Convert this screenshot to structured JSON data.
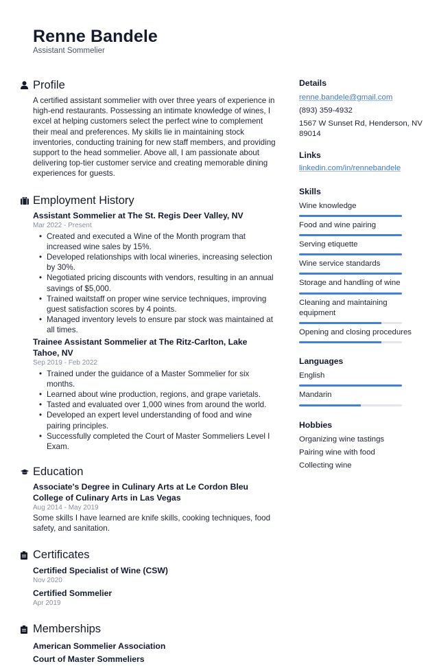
{
  "header": {
    "name": "Renne Bandele",
    "title": "Assistant Sommelier"
  },
  "colors": {
    "accent": "#3d7fe8",
    "bar_track": "#e3e5ea",
    "text": "#1f2433",
    "muted": "#8b909c",
    "link": "#3d78d8"
  },
  "profile": {
    "heading": "Profile",
    "icon": "user-icon",
    "text": "A certified assistant sommelier with over three years of experience in high-end restaurants. Possessing an intimate knowledge of wines, I excel at helping customers select the perfect wine to complement their meal and preferences. My skills lie in maintaining stock inventories, conducting training for new staff members, and providing support to the head sommelier. Above all, I am passionate about delivering top-tier customer service and creating memorable dining experiences for guests."
  },
  "employment": {
    "heading": "Employment History",
    "icon": "briefcase-icon",
    "jobs": [
      {
        "title": "Assistant Sommelier at The St. Regis Deer Valley, NV",
        "dates": "Mar 2022 - Present",
        "bullets": [
          "Created and executed a Wine of the Month program that increased wine sales by 15%.",
          "Developed relationships with local wineries, increasing selection by 30%.",
          "Negotiated pricing discounts with vendors, resulting in an annual savings of $5,000.",
          "Trained waitstaff on proper wine service techniques, improving guest satisfaction scores by 4 points.",
          "Managed inventory levels to ensure par stock was maintained at all times."
        ]
      },
      {
        "title": "Trainee Assistant Sommelier at The Ritz-Carlton, Lake Tahoe, NV",
        "dates": "Sep 2019 - Feb 2022",
        "bullets": [
          "Trained under the guidance of a Master Sommelier for six months.",
          "Learned about wine production, regions, and grape varietals.",
          "Tasted and evaluated over 1,000 wines from around the world.",
          "Developed an expert level understanding of food and wine pairing principles.",
          "Successfully completed the Court of Master Sommeliers Level I Exam."
        ]
      }
    ]
  },
  "education": {
    "heading": "Education",
    "icon": "graduation-cap-icon",
    "entries": [
      {
        "title": "Associate's Degree in Culinary Arts at Le Cordon Bleu College of Culinary Arts in Las Vegas",
        "dates": "Aug 2014 - May 2019",
        "description": "Some skills I have learned are knife skills, cooking techniques, food safety, and sanitation."
      }
    ]
  },
  "certificates": {
    "heading": "Certificates",
    "icon": "clipboard-icon",
    "items": [
      {
        "title": "Certified Specialist of Wine (CSW)",
        "date": "Nov 2020"
      },
      {
        "title": "Certified Sommelier",
        "date": "Apr 2019"
      }
    ]
  },
  "memberships": {
    "heading": "Memberships",
    "icon": "clipboard-icon",
    "items": [
      "American Sommelier Association",
      "Court of Master Sommeliers"
    ]
  },
  "details": {
    "heading": "Details",
    "email": "renne.bandele@gmail.com",
    "phone": "(893) 359-4932",
    "address": "1567 W Sunset Rd, Henderson, NV 89014"
  },
  "links": {
    "heading": "Links",
    "items": [
      "linkedin.com/in/rennebandele"
    ]
  },
  "skills": {
    "heading": "Skills",
    "items": [
      {
        "label": "Wine knowledge",
        "level": 100
      },
      {
        "label": "Food and wine pairing",
        "level": 100
      },
      {
        "label": "Serving etiquette",
        "level": 100
      },
      {
        "label": "Wine service standards",
        "level": 100
      },
      {
        "label": "Storage and handling of wine",
        "level": 100
      },
      {
        "label": "Cleaning and maintaining equipment",
        "level": 80
      },
      {
        "label": "Opening and closing procedures",
        "level": 80
      }
    ]
  },
  "languages": {
    "heading": "Languages",
    "items": [
      {
        "label": "English",
        "level": 100
      },
      {
        "label": "Mandarin",
        "level": 60
      }
    ]
  },
  "hobbies": {
    "heading": "Hobbies",
    "items": [
      "Organizing wine tastings",
      "Pairing wine with food",
      "Collecting wine"
    ]
  }
}
